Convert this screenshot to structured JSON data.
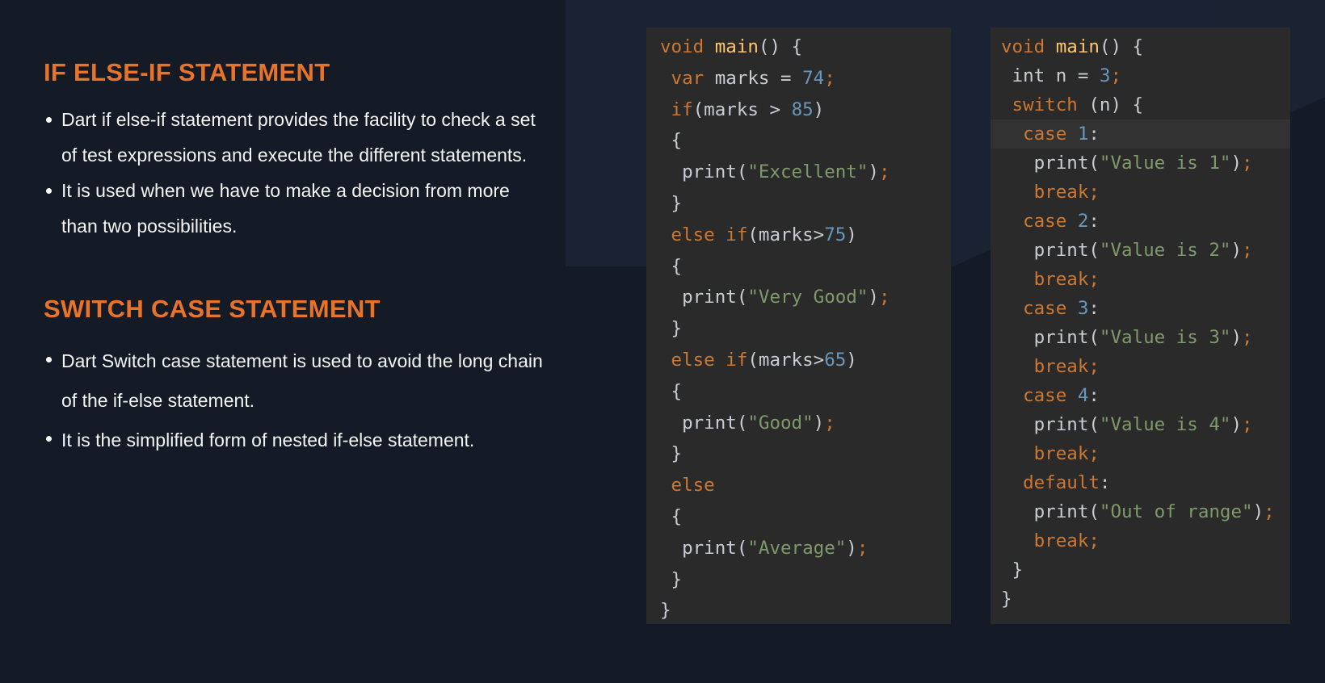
{
  "colors": {
    "background": "#151b26",
    "heading": "#e8732a",
    "panel": "#2a2a2a",
    "keyword": "#cc7832",
    "function": "#ffc66d",
    "number": "#6897bb",
    "string": "#7f9a6a"
  },
  "sections": [
    {
      "title": "IF ELSE-IF STATEMENT",
      "bullets": [
        [
          "Dart if else-if statement provides the facility to check a set",
          "of test expressions and execute the different statements."
        ],
        [
          "It is used when we have to make a decision from more",
          "than two possibilities."
        ]
      ]
    },
    {
      "title": "SWITCH CASE STATEMENT",
      "bullets": [
        [
          "Dart Switch case statement is used to avoid the long chain",
          "of the if-else statement."
        ],
        [
          "It is the simplified form of nested if-else statement."
        ]
      ]
    }
  ],
  "code_panels": [
    {
      "lines": [
        [
          [
            "kw",
            "void "
          ],
          [
            "fn",
            "main"
          ],
          [
            "plain",
            "() {"
          ]
        ],
        [
          [
            "plain",
            " "
          ],
          [
            "kw",
            "var "
          ],
          [
            "plain",
            "marks = "
          ],
          [
            "num",
            "74"
          ],
          [
            "kw",
            ";"
          ]
        ],
        [
          [
            "plain",
            " "
          ],
          [
            "kw",
            "if"
          ],
          [
            "plain",
            "(marks > "
          ],
          [
            "num",
            "85"
          ],
          [
            "plain",
            ")"
          ]
        ],
        [
          [
            "plain",
            " {"
          ]
        ],
        [
          [
            "plain",
            "  print("
          ],
          [
            "str",
            "\"Excellent\""
          ],
          [
            "plain",
            ")"
          ],
          [
            "kw",
            ";"
          ]
        ],
        [
          [
            "plain",
            " }"
          ]
        ],
        [
          [
            "plain",
            " "
          ],
          [
            "kw",
            "else if"
          ],
          [
            "plain",
            "(marks>"
          ],
          [
            "num",
            "75"
          ],
          [
            "plain",
            ")"
          ]
        ],
        [
          [
            "plain",
            " {"
          ]
        ],
        [
          [
            "plain",
            "  print("
          ],
          [
            "str",
            "\"Very Good\""
          ],
          [
            "plain",
            ")"
          ],
          [
            "kw",
            ";"
          ]
        ],
        [
          [
            "plain",
            " }"
          ]
        ],
        [
          [
            "plain",
            " "
          ],
          [
            "kw",
            "else if"
          ],
          [
            "plain",
            "(marks>"
          ],
          [
            "num",
            "65"
          ],
          [
            "plain",
            ")"
          ]
        ],
        [
          [
            "plain",
            " {"
          ]
        ],
        [
          [
            "plain",
            "  print("
          ],
          [
            "str",
            "\"Good\""
          ],
          [
            "plain",
            ")"
          ],
          [
            "kw",
            ";"
          ]
        ],
        [
          [
            "plain",
            " }"
          ]
        ],
        [
          [
            "plain",
            " "
          ],
          [
            "kw",
            "else"
          ]
        ],
        [
          [
            "plain",
            " {"
          ]
        ],
        [
          [
            "plain",
            "  print("
          ],
          [
            "str",
            "\"Average\""
          ],
          [
            "plain",
            ")"
          ],
          [
            "kw",
            ";"
          ]
        ],
        [
          [
            "plain",
            " }"
          ]
        ],
        [
          [
            "plain",
            "}"
          ]
        ]
      ]
    },
    {
      "lines": [
        [
          [
            "kw",
            "void "
          ],
          [
            "fn",
            "main"
          ],
          [
            "plain",
            "() {"
          ]
        ],
        [
          [
            "plain",
            " int n = "
          ],
          [
            "num",
            "3"
          ],
          [
            "kw",
            ";"
          ]
        ],
        [
          [
            "plain",
            " "
          ],
          [
            "kw",
            "switch"
          ],
          [
            "plain",
            " (n) {"
          ]
        ],
        [
          [
            "plain",
            "  "
          ],
          [
            "kw",
            "case "
          ],
          [
            "num",
            "1"
          ],
          [
            "plain",
            ":"
          ]
        ],
        [
          [
            "plain",
            "   print("
          ],
          [
            "str",
            "\"Value is 1\""
          ],
          [
            "plain",
            ")"
          ],
          [
            "kw",
            ";"
          ]
        ],
        [
          [
            "plain",
            "   "
          ],
          [
            "kw",
            "break;"
          ]
        ],
        [
          [
            "plain",
            "  "
          ],
          [
            "kw",
            "case "
          ],
          [
            "num",
            "2"
          ],
          [
            "plain",
            ":"
          ]
        ],
        [
          [
            "plain",
            "   print("
          ],
          [
            "str",
            "\"Value is 2\""
          ],
          [
            "plain",
            ")"
          ],
          [
            "kw",
            ";"
          ]
        ],
        [
          [
            "plain",
            "   "
          ],
          [
            "kw",
            "break;"
          ]
        ],
        [
          [
            "plain",
            "  "
          ],
          [
            "kw",
            "case "
          ],
          [
            "num",
            "3"
          ],
          [
            "plain",
            ":"
          ]
        ],
        [
          [
            "plain",
            "   print("
          ],
          [
            "str",
            "\"Value is 3\""
          ],
          [
            "plain",
            ")"
          ],
          [
            "kw",
            ";"
          ]
        ],
        [
          [
            "plain",
            "   "
          ],
          [
            "kw",
            "break;"
          ]
        ],
        [
          [
            "plain",
            "  "
          ],
          [
            "kw",
            "case "
          ],
          [
            "num",
            "4"
          ],
          [
            "plain",
            ":"
          ]
        ],
        [
          [
            "plain",
            "   print("
          ],
          [
            "str",
            "\"Value is 4\""
          ],
          [
            "plain",
            ")"
          ],
          [
            "kw",
            ";"
          ]
        ],
        [
          [
            "plain",
            "   "
          ],
          [
            "kw",
            "break;"
          ]
        ],
        [
          [
            "plain",
            "  "
          ],
          [
            "kw",
            "default"
          ],
          [
            "plain",
            ":"
          ]
        ],
        [
          [
            "plain",
            "   print("
          ],
          [
            "str",
            "\"Out of range\""
          ],
          [
            "plain",
            ")"
          ],
          [
            "kw",
            ";"
          ]
        ],
        [
          [
            "plain",
            "   "
          ],
          [
            "kw",
            "break;"
          ]
        ],
        [
          [
            "plain",
            " }"
          ]
        ],
        [
          [
            "plain",
            "}"
          ]
        ]
      ],
      "highlighted_line": 3
    }
  ]
}
